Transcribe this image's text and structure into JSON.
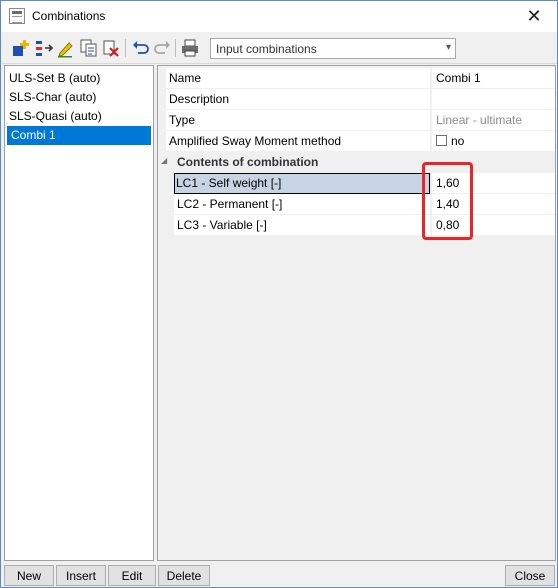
{
  "window": {
    "title": "Combinations",
    "close_glyph": "✕"
  },
  "toolbar": {
    "icons": [
      "new-combination-icon",
      "insert-combination-icon",
      "edit-icon",
      "copy-icon",
      "delete-icon",
      "undo-icon",
      "redo-icon",
      "print-icon"
    ],
    "combo_value": "Input combinations"
  },
  "list": {
    "items": [
      {
        "label": "ULS-Set B (auto)"
      },
      {
        "label": "SLS-Char (auto)"
      },
      {
        "label": "SLS-Quasi (auto)"
      },
      {
        "label": "Combi 1",
        "selected": true
      }
    ]
  },
  "properties": {
    "name_label": "Name",
    "name_value": "Combi 1",
    "description_label": "Description",
    "description_value": "",
    "type_label": "Type",
    "type_value": "Linear - ultimate",
    "sway_label": "Amplified Sway Moment method",
    "sway_value": "no",
    "section_title": "Contents of combination",
    "contents": [
      {
        "label": "LC1 - Self weight [-]",
        "value": "1,60"
      },
      {
        "label": "LC2 - Permanent [-]",
        "value": "1,40"
      },
      {
        "label": "LC3 - Variable [-]",
        "value": "0,80"
      }
    ]
  },
  "buttons": {
    "new": "New",
    "insert": "Insert",
    "edit": "Edit",
    "delete": "Delete",
    "close": "Close"
  },
  "colors": {
    "selection": "#0078d7",
    "highlight_box": "#e8252b",
    "active_row": "#c8d3e3"
  }
}
